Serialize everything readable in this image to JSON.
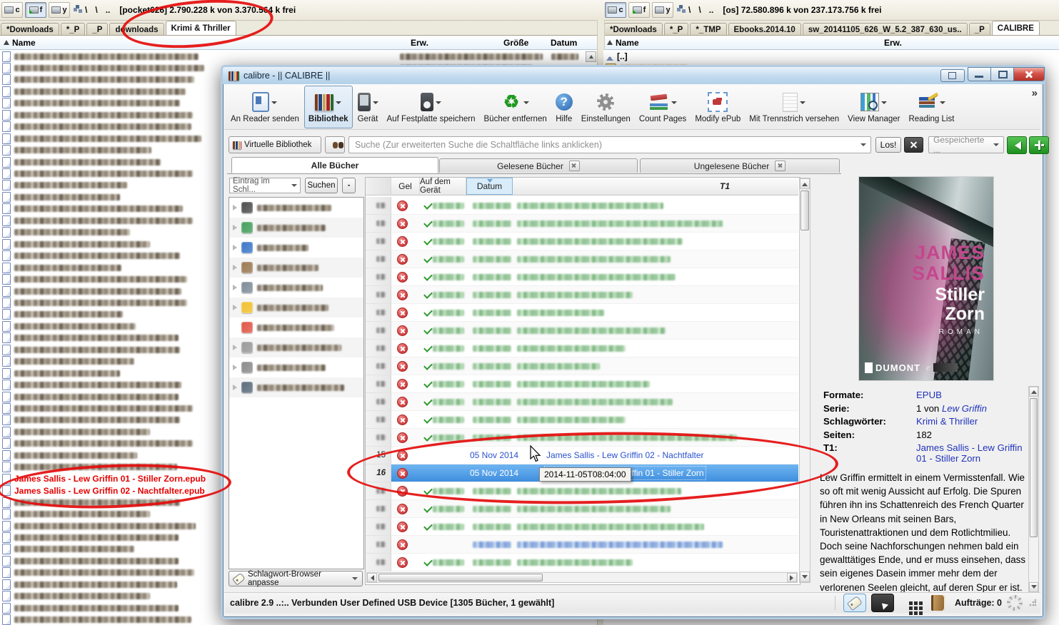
{
  "file_manager": {
    "left_drive": {
      "buttons": [
        "c",
        "f",
        "y"
      ],
      "active_drive": "f",
      "slashes": [
        "\\",
        "\\",
        ".."
      ],
      "info": "[pocket626]  2.790.228 k von 3.370.564 k frei"
    },
    "right_drive": {
      "buttons": [
        "c",
        "f",
        "y"
      ],
      "active_drive": "c",
      "slashes": [
        "\\",
        "\\",
        ".."
      ],
      "info": "[os]  72.580.896 k von 237.173.756 k frei"
    },
    "left_tabs": [
      "*Downloads",
      "*_P",
      "_P",
      "downloads",
      "Krimi & Thriller"
    ],
    "right_tabs": [
      "*Downloads",
      "*_P",
      "*_TMP",
      "Ebooks.2014.10",
      "sw_20141105_626_W_5.2_387_630_us..",
      "_P",
      "CALIBRE"
    ],
    "headers_left": {
      "name": "Name",
      "ext": "Erw.",
      "size": "Größe",
      "date": "Datum"
    },
    "headers_right": {
      "name": "Name",
      "ext": "Erw."
    },
    "parent_dir": "[..]",
    "marked_files": [
      "James Sallis - Lew Griffin 01 - Stiller Zorn.epub",
      "James Sallis - Lew Griffin 02 - Nachtfalter.epub"
    ]
  },
  "calibre": {
    "window_title": "calibre - || CALIBRE ||",
    "toolbar": {
      "overflow": "»",
      "items": [
        {
          "label": "An Reader senden",
          "icon": "reader",
          "arrow": true,
          "active": false
        },
        {
          "label": "Bibliothek",
          "icon": "library",
          "arrow": true,
          "active": true
        },
        {
          "label": "Gerät",
          "icon": "device",
          "arrow": true,
          "active": false
        },
        {
          "label": "Auf Festplatte speichern",
          "icon": "save",
          "arrow": true,
          "active": false
        },
        {
          "label": "Bücher entfernen",
          "icon": "remove",
          "arrow": true,
          "active": false
        },
        {
          "label": "Hilfe",
          "icon": "help",
          "arrow": false,
          "active": false
        },
        {
          "label": "Einstellungen",
          "icon": "settings",
          "arrow": false,
          "active": false
        },
        {
          "label": "Count Pages",
          "icon": "count",
          "arrow": true,
          "active": false
        },
        {
          "label": "Modify ePub",
          "icon": "modify",
          "arrow": false,
          "active": false
        },
        {
          "label": "Mit Trennstrich versehen",
          "icon": "trenn",
          "arrow": true,
          "active": false
        },
        {
          "label": "View Manager",
          "icon": "viewmgr",
          "arrow": true,
          "active": false
        },
        {
          "label": "Reading List",
          "icon": "readlist",
          "arrow": true,
          "active": false
        }
      ]
    },
    "icon_glyphs": {
      "remove": "♻",
      "help": "?"
    },
    "search": {
      "virtual_library": "Virtuelle Bibliothek",
      "placeholder": "Suche (Zur erweiterten Suche die Schaltfläche links anklicken)",
      "go": "Los!",
      "saved": "Gespeicherte ..."
    },
    "view_tabs": [
      {
        "label": "Alle Bücher",
        "closable": false
      },
      {
        "label": "Gelesene Bücher",
        "closable": true
      },
      {
        "label": "Ungelesene Bücher",
        "closable": true
      }
    ],
    "tag_panel": {
      "filter": "Eintrag im Schl...",
      "search": "Suchen",
      "minus": "-",
      "customize": "Schlagwort-Browser anpasse"
    },
    "table": {
      "headers": [
        "Gel",
        "Auf dem Gerät",
        "Datum",
        "T1"
      ],
      "visible_rows": [
        {
          "num": "15",
          "date": "05 Nov 2014",
          "title": "James Sallis - Lew Griffin 02 - Nachtfalter",
          "selected": false
        },
        {
          "num": "16",
          "date": "05 Nov 2014",
          "title": "James Sallis - Lew Griffin 01 - Stiller Zorn",
          "selected": true
        }
      ],
      "tooltip": "2014-11-05T08:04:00"
    },
    "cover": {
      "author": "JAMES SALLIS",
      "title": "Stiller Zorn",
      "genre": "ROMAN",
      "publisher": "DUMONT"
    },
    "details": {
      "formate_label": "Formate:",
      "formate": "EPUB",
      "serie_label": "Serie:",
      "serie_prefix": "1 von ",
      "serie": "Lew Griffin",
      "tags_label": "Schlagwörter:",
      "tags": "Krimi & Thriller",
      "pages_label": "Seiten:",
      "pages": "182",
      "t1_label": "T1:",
      "t1": "James Sallis - Lew Griffin 01 - Stiller Zorn"
    },
    "description": "Lew Griffin ermittelt in einem Vermisstenfall. Wie so oft mit wenig Aussicht auf Erfolg. Die Spuren führen ihn ins Schattenreich des French Quarter in New Orleans mit seinen Bars, Touristenattraktionen und dem Rotlichtmilieu. Doch seine Nachforschungen nehmen bald ein gewalttätiges Ende, und er muss einsehen, dass sein eigenes Dasein immer mehr dem der verlorenen Seelen gleicht, auf deren Spur er ist. Lew Griffin ist selbst ein Verlorener, ein Gefangener der Flasche, seiner Vergangenheit und seiner schwarzen Hautfarbe. Als",
    "status": {
      "text": "calibre 2.9 ..:.. Verbunden User Defined USB Device   [1305 Bücher, 1 gewählt]",
      "jobs": "Aufträge: 0"
    }
  }
}
